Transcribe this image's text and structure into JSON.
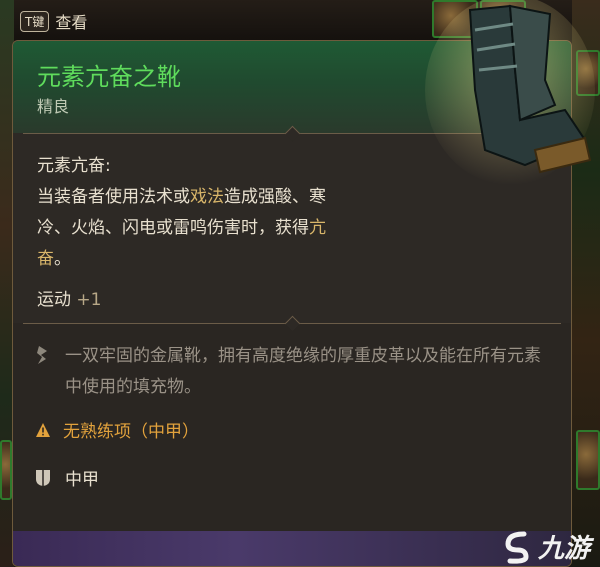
{
  "hint": {
    "key": "T键",
    "label": "查看"
  },
  "item": {
    "name": "元素亢奋之靴",
    "rarity": "精良",
    "effect_title": "元素亢奋:",
    "effect_line1_a": "当装备者使用法术或",
    "effect_line1_hl": "戏法",
    "effect_line1_b": "造成强酸、寒",
    "effect_line2_a": "冷、火焰、闪电或雷鸣伤害时，获得",
    "effect_line2_hl": "亢",
    "effect_line3_hl": "奋",
    "effect_line3_b": "。",
    "stat_name": "运动",
    "stat_value": "+1",
    "description": "一双牢固的金属靴，拥有高度绝缘的厚重皮革以及能在所有元素中使用的填充物。",
    "warning": "无熟练项（中甲）",
    "armor_type": "中甲"
  },
  "watermark": "九游",
  "icons": [
    "key-hint-icon",
    "boots-icon",
    "quill-icon",
    "warning-icon",
    "armor-icon",
    "watermark-logo-icon"
  ],
  "colors": {
    "item_name": "#5fdc5c",
    "highlight": "#d9b66a",
    "warning": "#e2a23c",
    "header_green": "#1f5a34"
  }
}
